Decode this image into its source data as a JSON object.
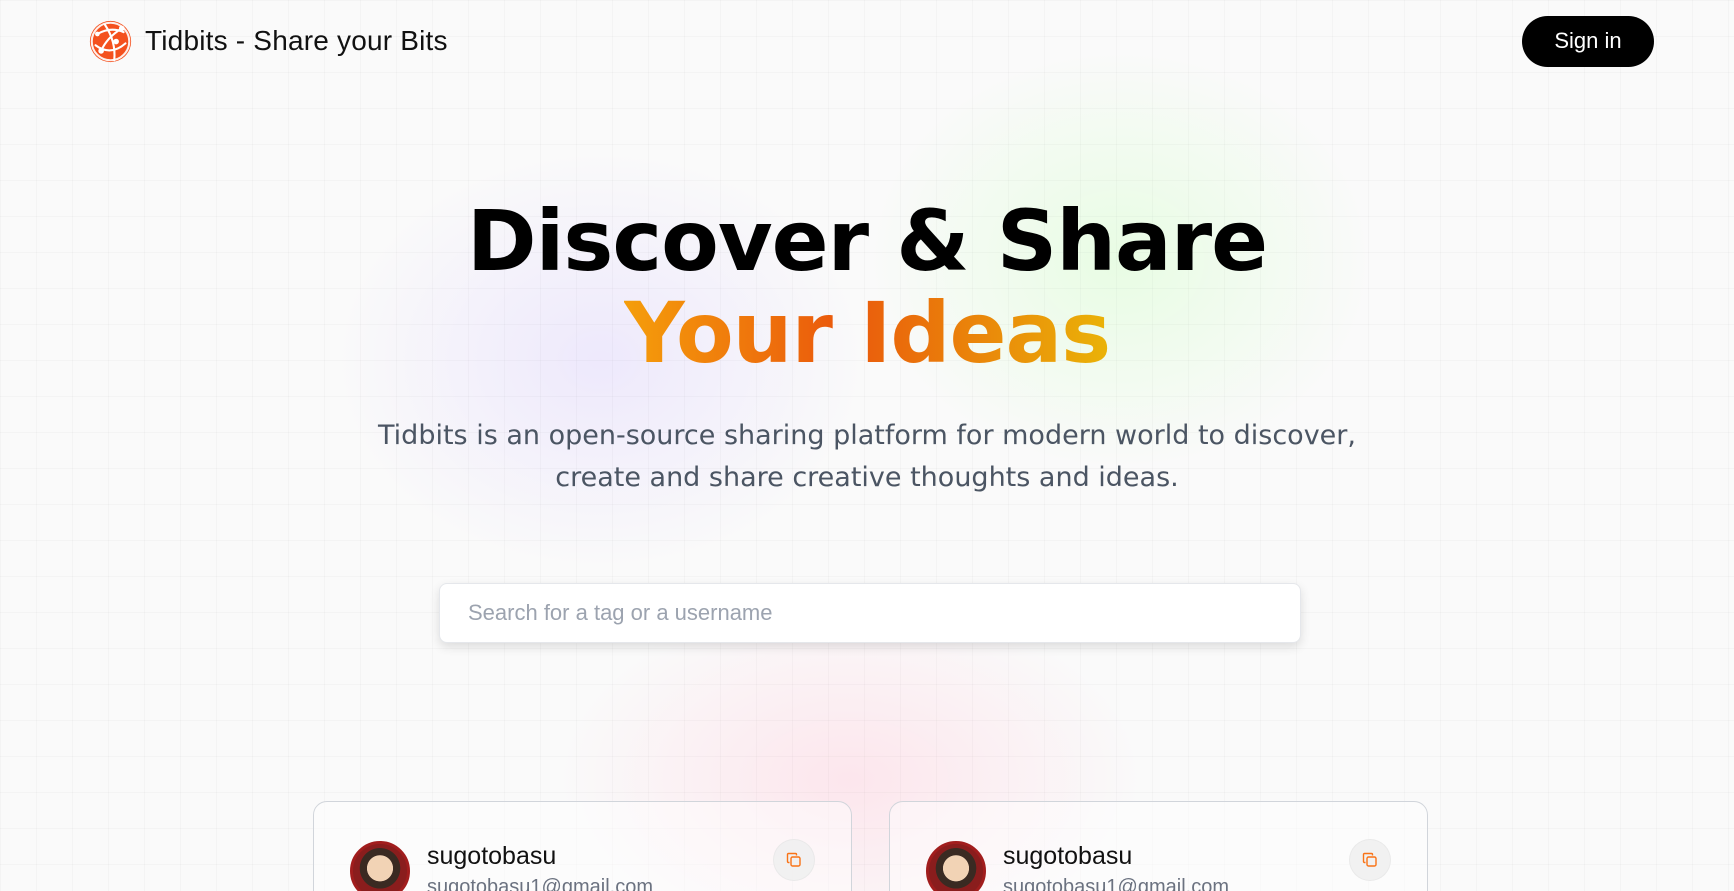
{
  "nav": {
    "brand_title": "Tidbits - Share your Bits",
    "signin_label": "Sign in"
  },
  "hero": {
    "title_line1": "Discover & Share",
    "title_line2": "Your Ideas",
    "subtitle": "Tidbits is an open-source sharing platform for modern world to discover, create and share creative thoughts and ideas."
  },
  "search": {
    "placeholder": "Search for a tag or a username",
    "value": ""
  },
  "posts": [
    {
      "username": "sugotobasu",
      "email": "sugotobasu1@gmail.com"
    },
    {
      "username": "sugotobasu",
      "email": "sugotobasu1@gmail.com"
    }
  ],
  "colors": {
    "brand_accent": "#f97316",
    "gradient_start": "#f59e0b",
    "gradient_mid": "#ea580c",
    "gradient_end": "#eab308",
    "signin_bg": "#000000"
  },
  "icons": {
    "logo": "globe-network-icon",
    "copy": "copy-icon"
  }
}
